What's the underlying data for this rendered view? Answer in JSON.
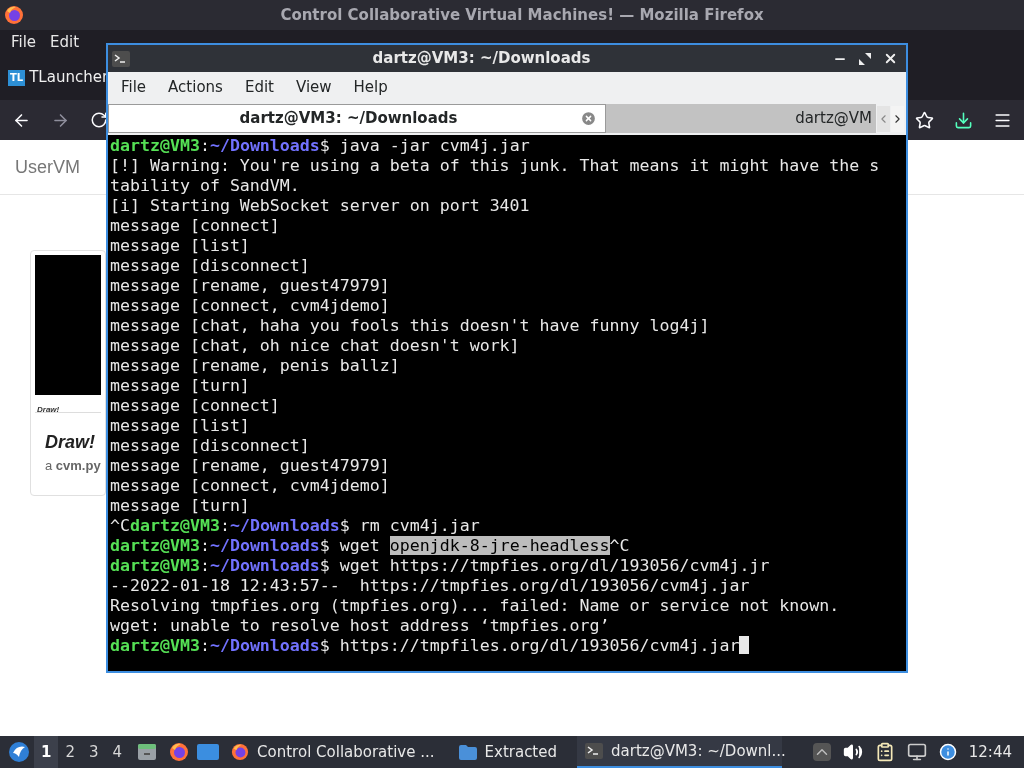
{
  "browser": {
    "title": "Control Collaborative Virtual Machines! — Mozilla Firefox",
    "menu": [
      "File",
      "Edit"
    ],
    "tab": {
      "icon_text": "TL",
      "label": "TLauncher"
    },
    "page": {
      "site_title": "UserVM",
      "card": {
        "thumb_caption": "Draw!",
        "title": "Draw!",
        "subtitle": "a **cvm.py**"
      }
    }
  },
  "terminal": {
    "title": "dartz@VM3: ~/Downloads",
    "menu": [
      "File",
      "Actions",
      "Edit",
      "View",
      "Help"
    ],
    "tabs": [
      {
        "label": "dartz@VM3: ~/Downloads",
        "selected": true
      },
      {
        "label": "dartz@VM",
        "selected": false
      }
    ],
    "lines": [
      [
        {
          "kind": "user",
          "text": "dartz@VM3"
        },
        {
          "kind": "plain",
          "text": ":"
        },
        {
          "kind": "path",
          "text": "~/Downloads"
        },
        {
          "kind": "plain",
          "text": "$ java -jar cvm4j.jar"
        }
      ],
      [
        {
          "kind": "plain",
          "text": "[!] Warning: You're using a beta of this junk. That means it might have the s"
        }
      ],
      [
        {
          "kind": "plain",
          "text": "tability of SandVM."
        }
      ],
      [
        {
          "kind": "plain",
          "text": "[i] Starting WebSocket server on port 3401"
        }
      ],
      [
        {
          "kind": "plain",
          "text": "message [connect]"
        }
      ],
      [
        {
          "kind": "plain",
          "text": "message [list]"
        }
      ],
      [
        {
          "kind": "plain",
          "text": "message [disconnect]"
        }
      ],
      [
        {
          "kind": "plain",
          "text": "message [rename, guest47979]"
        }
      ],
      [
        {
          "kind": "plain",
          "text": "message [connect, cvm4jdemo]"
        }
      ],
      [
        {
          "kind": "plain",
          "text": "message [chat, haha you fools this doesn't have funny log4j]"
        }
      ],
      [
        {
          "kind": "plain",
          "text": "message [chat, oh nice chat doesn't work]"
        }
      ],
      [
        {
          "kind": "plain",
          "text": "message [rename, penis ballz]"
        }
      ],
      [
        {
          "kind": "plain",
          "text": "message [turn]"
        }
      ],
      [
        {
          "kind": "plain",
          "text": "message [connect]"
        }
      ],
      [
        {
          "kind": "plain",
          "text": "message [list]"
        }
      ],
      [
        {
          "kind": "plain",
          "text": "message [disconnect]"
        }
      ],
      [
        {
          "kind": "plain",
          "text": "message [rename, guest47979]"
        }
      ],
      [
        {
          "kind": "plain",
          "text": "message [connect, cvm4jdemo]"
        }
      ],
      [
        {
          "kind": "plain",
          "text": "message [turn]"
        }
      ],
      [
        {
          "kind": "plain",
          "text": "^C"
        },
        {
          "kind": "user",
          "text": "dartz@VM3"
        },
        {
          "kind": "plain",
          "text": ":"
        },
        {
          "kind": "path",
          "text": "~/Downloads"
        },
        {
          "kind": "plain",
          "text": "$ rm cvm4j.jar"
        }
      ],
      [
        {
          "kind": "user",
          "text": "dartz@VM3"
        },
        {
          "kind": "plain",
          "text": ":"
        },
        {
          "kind": "path",
          "text": "~/Downloads"
        },
        {
          "kind": "plain",
          "text": "$ wget "
        },
        {
          "kind": "selected",
          "text": "openjdk-8-jre-headless"
        },
        {
          "kind": "plain",
          "text": "^C"
        }
      ],
      [
        {
          "kind": "user",
          "text": "dartz@VM3"
        },
        {
          "kind": "plain",
          "text": ":"
        },
        {
          "kind": "path",
          "text": "~/Downloads"
        },
        {
          "kind": "plain",
          "text": "$ wget https://tmpfies.org/dl/193056/cvm4j.jr"
        }
      ],
      [
        {
          "kind": "plain",
          "text": "--2022-01-18 12:43:57--  https://tmpfies.org/dl/193056/cvm4j.jar"
        }
      ],
      [
        {
          "kind": "plain",
          "text": "Resolving tmpfies.org (tmpfies.org)... failed: Name or service not known."
        }
      ],
      [
        {
          "kind": "plain",
          "text": "wget: unable to resolve host address ‘tmpfies.org’"
        }
      ],
      [
        {
          "kind": "user",
          "text": "dartz@VM3"
        },
        {
          "kind": "plain",
          "text": ":"
        },
        {
          "kind": "path",
          "text": "~/Downloads"
        },
        {
          "kind": "plain",
          "text": "$ https://tmpfiles.org/dl/193056/cvm4j.jar"
        }
      ]
    ],
    "cursor": true
  },
  "taskbar": {
    "workspaces": [
      {
        "label": "1",
        "selected": true
      },
      {
        "label": "2",
        "selected": false
      },
      {
        "label": "3",
        "selected": false
      },
      {
        "label": "4",
        "selected": false
      }
    ],
    "tasks": [
      {
        "kind": "browser",
        "label": "Control Collaborative ...",
        "active": false
      },
      {
        "kind": "folder",
        "label": "Extracted",
        "active": false
      },
      {
        "kind": "terminal",
        "label": "dartz@VM3: ~/Downl...",
        "active": true
      }
    ],
    "clock": "12:44"
  }
}
